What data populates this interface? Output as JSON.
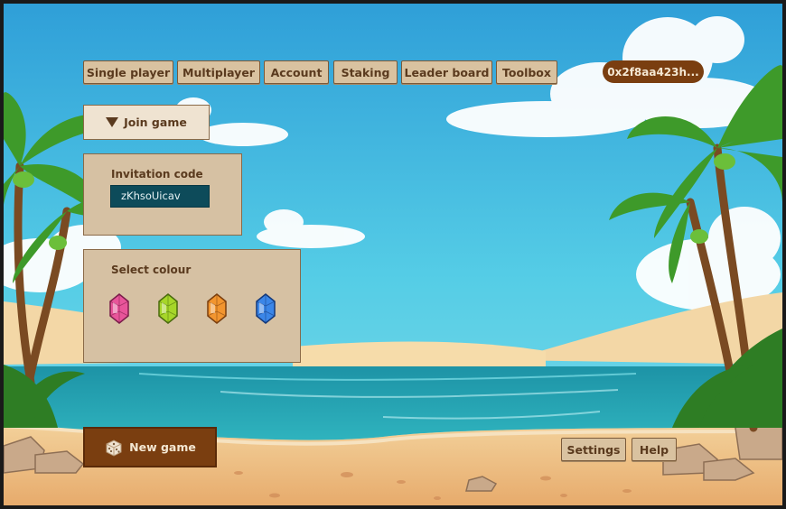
{
  "nav": {
    "single_player": "Single player",
    "multiplayer": "Multiplayer",
    "account": "Account",
    "staking": "Staking",
    "leader_board": "Leader board",
    "toolbox": "Toolbox"
  },
  "wallet": {
    "address": "0x2f8aa423h..."
  },
  "join": {
    "label": "Join game",
    "icon": "triangle-down-icon"
  },
  "invitation": {
    "title": "Invitation code",
    "value": "zKhsoUicav"
  },
  "colours": {
    "title": "Select colour",
    "options": [
      {
        "name": "pink",
        "color": "#e8559a"
      },
      {
        "name": "green",
        "color": "#a6d629"
      },
      {
        "name": "orange",
        "color": "#f2952f"
      },
      {
        "name": "blue",
        "color": "#3b86e8"
      }
    ]
  },
  "new_game": {
    "label": "New game",
    "icon": "dice-icon"
  },
  "footer": {
    "settings": "Settings",
    "help": "Help"
  }
}
